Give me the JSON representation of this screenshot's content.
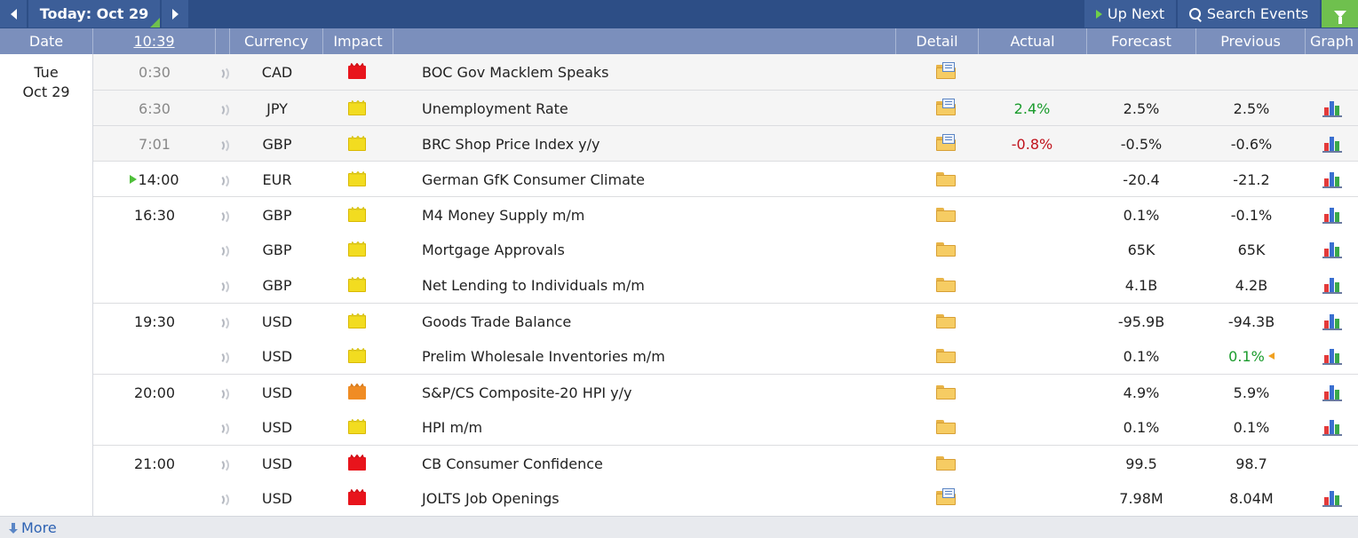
{
  "toolbar": {
    "today_label": "Today: Oct 29",
    "up_next_label": "Up Next",
    "search_label": "Search Events"
  },
  "columns": {
    "date": "Date",
    "time": "10:39",
    "currency": "Currency",
    "impact": "Impact",
    "detail": "Detail",
    "actual": "Actual",
    "forecast": "Forecast",
    "previous": "Previous",
    "graph": "Graph"
  },
  "date_block": {
    "weekday": "Tue",
    "date": "Oct 29"
  },
  "colors": {
    "positive": "#1a9b2c",
    "negative": "#c0121c",
    "header": "#7b8fbc",
    "toolbar": "#2d4e86",
    "filter": "#6fc04e"
  },
  "events": [
    {
      "time": "0:30",
      "currency": "CAD",
      "impact": "red",
      "event": "BOC Gov Macklem Speaks",
      "detail_icon": "folder-doc-icon",
      "actual": "",
      "actual_trend": "",
      "forecast": "",
      "previous": "",
      "previous_trend": "",
      "graph": false,
      "past": true,
      "current": false,
      "sep": false
    },
    {
      "time": "6:30",
      "currency": "JPY",
      "impact": "yellow",
      "event": "Unemployment Rate",
      "detail_icon": "folder-doc-icon",
      "actual": "2.4%",
      "actual_trend": "pos",
      "forecast": "2.5%",
      "previous": "2.5%",
      "previous_trend": "",
      "graph": true,
      "past": true,
      "current": false,
      "sep": true
    },
    {
      "time": "7:01",
      "currency": "GBP",
      "impact": "yellow",
      "event": "BRC Shop Price Index y/y",
      "detail_icon": "folder-doc-icon",
      "actual": "-0.8%",
      "actual_trend": "neg",
      "forecast": "-0.5%",
      "previous": "-0.6%",
      "previous_trend": "",
      "graph": true,
      "past": true,
      "current": false,
      "sep": true
    },
    {
      "time": "14:00",
      "currency": "EUR",
      "impact": "yellow",
      "event": "German GfK Consumer Climate",
      "detail_icon": "folder-icon",
      "actual": "",
      "actual_trend": "",
      "forecast": "-20.4",
      "previous": "-21.2",
      "previous_trend": "",
      "graph": true,
      "past": false,
      "current": true,
      "sep": true
    },
    {
      "time": "16:30",
      "currency": "GBP",
      "impact": "yellow",
      "event": "M4 Money Supply m/m",
      "detail_icon": "folder-icon",
      "actual": "",
      "actual_trend": "",
      "forecast": "0.1%",
      "previous": "-0.1%",
      "previous_trend": "",
      "graph": true,
      "past": false,
      "current": false,
      "sep": true
    },
    {
      "time": "",
      "currency": "GBP",
      "impact": "yellow",
      "event": "Mortgage Approvals",
      "detail_icon": "folder-icon",
      "actual": "",
      "actual_trend": "",
      "forecast": "65K",
      "previous": "65K",
      "previous_trend": "",
      "graph": true,
      "past": false,
      "current": false,
      "sep": false
    },
    {
      "time": "",
      "currency": "GBP",
      "impact": "yellow",
      "event": "Net Lending to Individuals m/m",
      "detail_icon": "folder-icon",
      "actual": "",
      "actual_trend": "",
      "forecast": "4.1B",
      "previous": "4.2B",
      "previous_trend": "",
      "graph": true,
      "past": false,
      "current": false,
      "sep": false
    },
    {
      "time": "19:30",
      "currency": "USD",
      "impact": "yellow",
      "event": "Goods Trade Balance",
      "detail_icon": "folder-icon",
      "actual": "",
      "actual_trend": "",
      "forecast": "-95.9B",
      "previous": "-94.3B",
      "previous_trend": "",
      "graph": true,
      "past": false,
      "current": false,
      "sep": true
    },
    {
      "time": "",
      "currency": "USD",
      "impact": "yellow",
      "event": "Prelim Wholesale Inventories m/m",
      "detail_icon": "folder-icon",
      "actual": "",
      "actual_trend": "",
      "forecast": "0.1%",
      "previous": "0.1%",
      "previous_trend": "pos",
      "graph": true,
      "past": false,
      "current": false,
      "sep": false
    },
    {
      "time": "20:00",
      "currency": "USD",
      "impact": "orange",
      "event": "S&P/CS Composite-20 HPI y/y",
      "detail_icon": "folder-icon",
      "actual": "",
      "actual_trend": "",
      "forecast": "4.9%",
      "previous": "5.9%",
      "previous_trend": "",
      "graph": true,
      "past": false,
      "current": false,
      "sep": true
    },
    {
      "time": "",
      "currency": "USD",
      "impact": "yellow",
      "event": "HPI m/m",
      "detail_icon": "folder-icon",
      "actual": "",
      "actual_trend": "",
      "forecast": "0.1%",
      "previous": "0.1%",
      "previous_trend": "",
      "graph": true,
      "past": false,
      "current": false,
      "sep": false
    },
    {
      "time": "21:00",
      "currency": "USD",
      "impact": "red",
      "event": "CB Consumer Confidence",
      "detail_icon": "folder-icon",
      "actual": "",
      "actual_trend": "",
      "forecast": "99.5",
      "previous": "98.7",
      "previous_trend": "",
      "graph": false,
      "past": false,
      "current": false,
      "sep": true
    },
    {
      "time": "",
      "currency": "USD",
      "impact": "red",
      "event": "JOLTS Job Openings",
      "detail_icon": "folder-doc-icon",
      "actual": "",
      "actual_trend": "",
      "forecast": "7.98M",
      "previous": "8.04M",
      "previous_trend": "",
      "graph": true,
      "past": false,
      "current": false,
      "sep": false
    }
  ],
  "footer": {
    "more_label": "More"
  }
}
